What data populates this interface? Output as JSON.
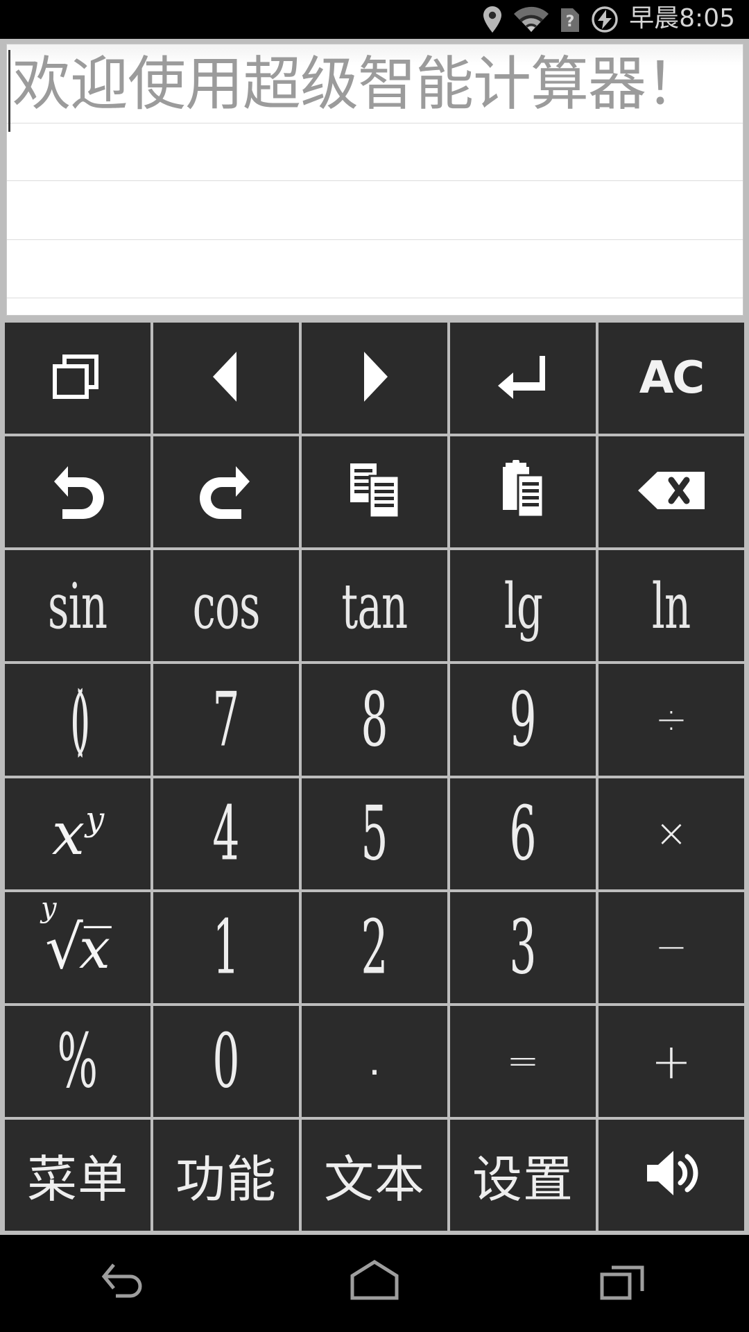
{
  "status_bar": {
    "time": "早晨8:05",
    "icons": [
      "location-pin-icon",
      "wifi-icon",
      "sim-unknown-icon",
      "charging-bolt-icon"
    ]
  },
  "display": {
    "placeholder": "欢迎使用超级智能计算器！",
    "value": "",
    "line_count": 5
  },
  "keypad": {
    "rows": [
      [
        {
          "name": "windows-button",
          "icon": "windows-icon",
          "type": "icon"
        },
        {
          "name": "cursor-left-button",
          "icon": "triangle-left-icon",
          "type": "icon"
        },
        {
          "name": "cursor-right-button",
          "icon": "triangle-right-icon",
          "type": "icon"
        },
        {
          "name": "enter-button",
          "icon": "enter-arrow-icon",
          "type": "icon"
        },
        {
          "name": "all-clear-button",
          "label": "AC",
          "type": "text-ac"
        }
      ],
      [
        {
          "name": "undo-button",
          "icon": "undo-icon",
          "type": "icon"
        },
        {
          "name": "redo-button",
          "icon": "redo-icon",
          "type": "icon"
        },
        {
          "name": "copy-button",
          "icon": "copy-icon",
          "type": "icon"
        },
        {
          "name": "paste-button",
          "icon": "paste-icon",
          "type": "icon"
        },
        {
          "name": "backspace-button",
          "icon": "backspace-icon",
          "type": "icon"
        }
      ],
      [
        {
          "name": "sin-button",
          "label": "sin",
          "type": "func"
        },
        {
          "name": "cos-button",
          "label": "cos",
          "type": "func"
        },
        {
          "name": "tan-button",
          "label": "tan",
          "type": "func"
        },
        {
          "name": "lg-button",
          "label": "lg",
          "type": "func"
        },
        {
          "name": "ln-button",
          "label": "ln",
          "type": "func"
        }
      ],
      [
        {
          "name": "parentheses-button",
          "label": "()",
          "type": "paren"
        },
        {
          "name": "digit-7-button",
          "label": "7",
          "type": "num"
        },
        {
          "name": "digit-8-button",
          "label": "8",
          "type": "num"
        },
        {
          "name": "digit-9-button",
          "label": "9",
          "type": "num"
        },
        {
          "name": "divide-button",
          "label": "÷",
          "type": "op"
        }
      ],
      [
        {
          "name": "power-button",
          "label": "x^y",
          "type": "power"
        },
        {
          "name": "digit-4-button",
          "label": "4",
          "type": "num"
        },
        {
          "name": "digit-5-button",
          "label": "5",
          "type": "num"
        },
        {
          "name": "digit-6-button",
          "label": "6",
          "type": "num"
        },
        {
          "name": "multiply-button",
          "label": "×",
          "type": "op"
        }
      ],
      [
        {
          "name": "nth-root-button",
          "label": "y√x",
          "type": "root"
        },
        {
          "name": "digit-1-button",
          "label": "1",
          "type": "num"
        },
        {
          "name": "digit-2-button",
          "label": "2",
          "type": "num"
        },
        {
          "name": "digit-3-button",
          "label": "3",
          "type": "num"
        },
        {
          "name": "minus-button",
          "label": "−",
          "type": "op"
        }
      ],
      [
        {
          "name": "percent-button",
          "label": "%",
          "type": "num"
        },
        {
          "name": "digit-0-button",
          "label": "0",
          "type": "num"
        },
        {
          "name": "decimal-point-button",
          "label": ".",
          "type": "dot"
        },
        {
          "name": "equals-button",
          "label": "=",
          "type": "op"
        },
        {
          "name": "plus-button",
          "label": "+",
          "type": "op-big"
        }
      ],
      [
        {
          "name": "menu-button",
          "label": "菜单",
          "type": "cn"
        },
        {
          "name": "function-button",
          "label": "功能",
          "type": "cn"
        },
        {
          "name": "text-button",
          "label": "文本",
          "type": "cn"
        },
        {
          "name": "settings-button",
          "label": "设置",
          "type": "cn"
        },
        {
          "name": "volume-button",
          "icon": "speaker-icon",
          "type": "icon"
        }
      ]
    ]
  },
  "navbar": {
    "items": [
      {
        "name": "nav-back-button",
        "icon": "back-arrow-icon"
      },
      {
        "name": "nav-home-button",
        "icon": "home-icon"
      },
      {
        "name": "nav-recents-button",
        "icon": "recents-icon"
      }
    ]
  },
  "colors": {
    "key_bg": "#2b2b2b",
    "frame": "#bdbdbd",
    "display_bg": "#ffffff",
    "placeholder": "#9b9b9b",
    "status_bg": "#000000",
    "icon": "#ffffff"
  }
}
